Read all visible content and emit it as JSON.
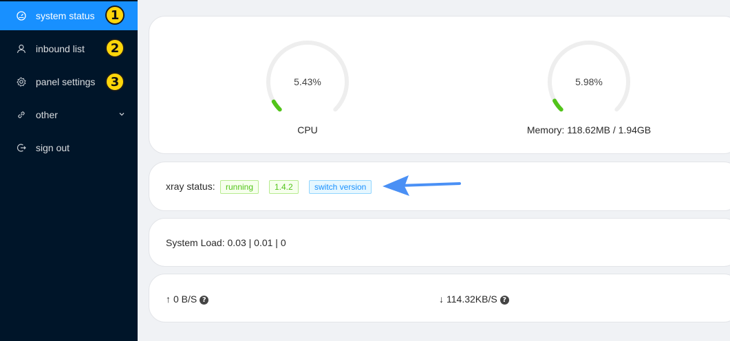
{
  "sidebar": {
    "items": [
      {
        "label": "system status",
        "icon": "dashboard-icon",
        "badge": "1"
      },
      {
        "label": "inbound list",
        "icon": "user-icon",
        "badge": "2"
      },
      {
        "label": "panel settings",
        "icon": "gear-icon",
        "badge": "3"
      },
      {
        "label": "other",
        "icon": "link-icon"
      },
      {
        "label": "sign out",
        "icon": "logout-icon"
      }
    ]
  },
  "cpu": {
    "percent_text": "5.43%",
    "percent": 5.43,
    "label": "CPU"
  },
  "memory": {
    "percent_text": "5.98%",
    "percent": 5.98,
    "label": "Memory: 118.62MB / 1.94GB"
  },
  "xray": {
    "label": "xray status:",
    "state": "running",
    "version": "1.4.2",
    "switch_label": "switch version"
  },
  "system_load": {
    "text": "System Load: 0.03 | 0.01 | 0"
  },
  "network": {
    "up": {
      "arrow": "↑",
      "value": "0 B/S"
    },
    "down": {
      "arrow": "↓",
      "value": "114.32KB/S"
    },
    "help_glyph": "?"
  },
  "colors": {
    "sidebar_bg": "#001529",
    "active_item": "#1890ff",
    "gauge_fill": "#52c41a",
    "gauge_track": "#eeeeee",
    "annotation_arrow": "#4a90f5",
    "badge": "#ffd60a"
  }
}
